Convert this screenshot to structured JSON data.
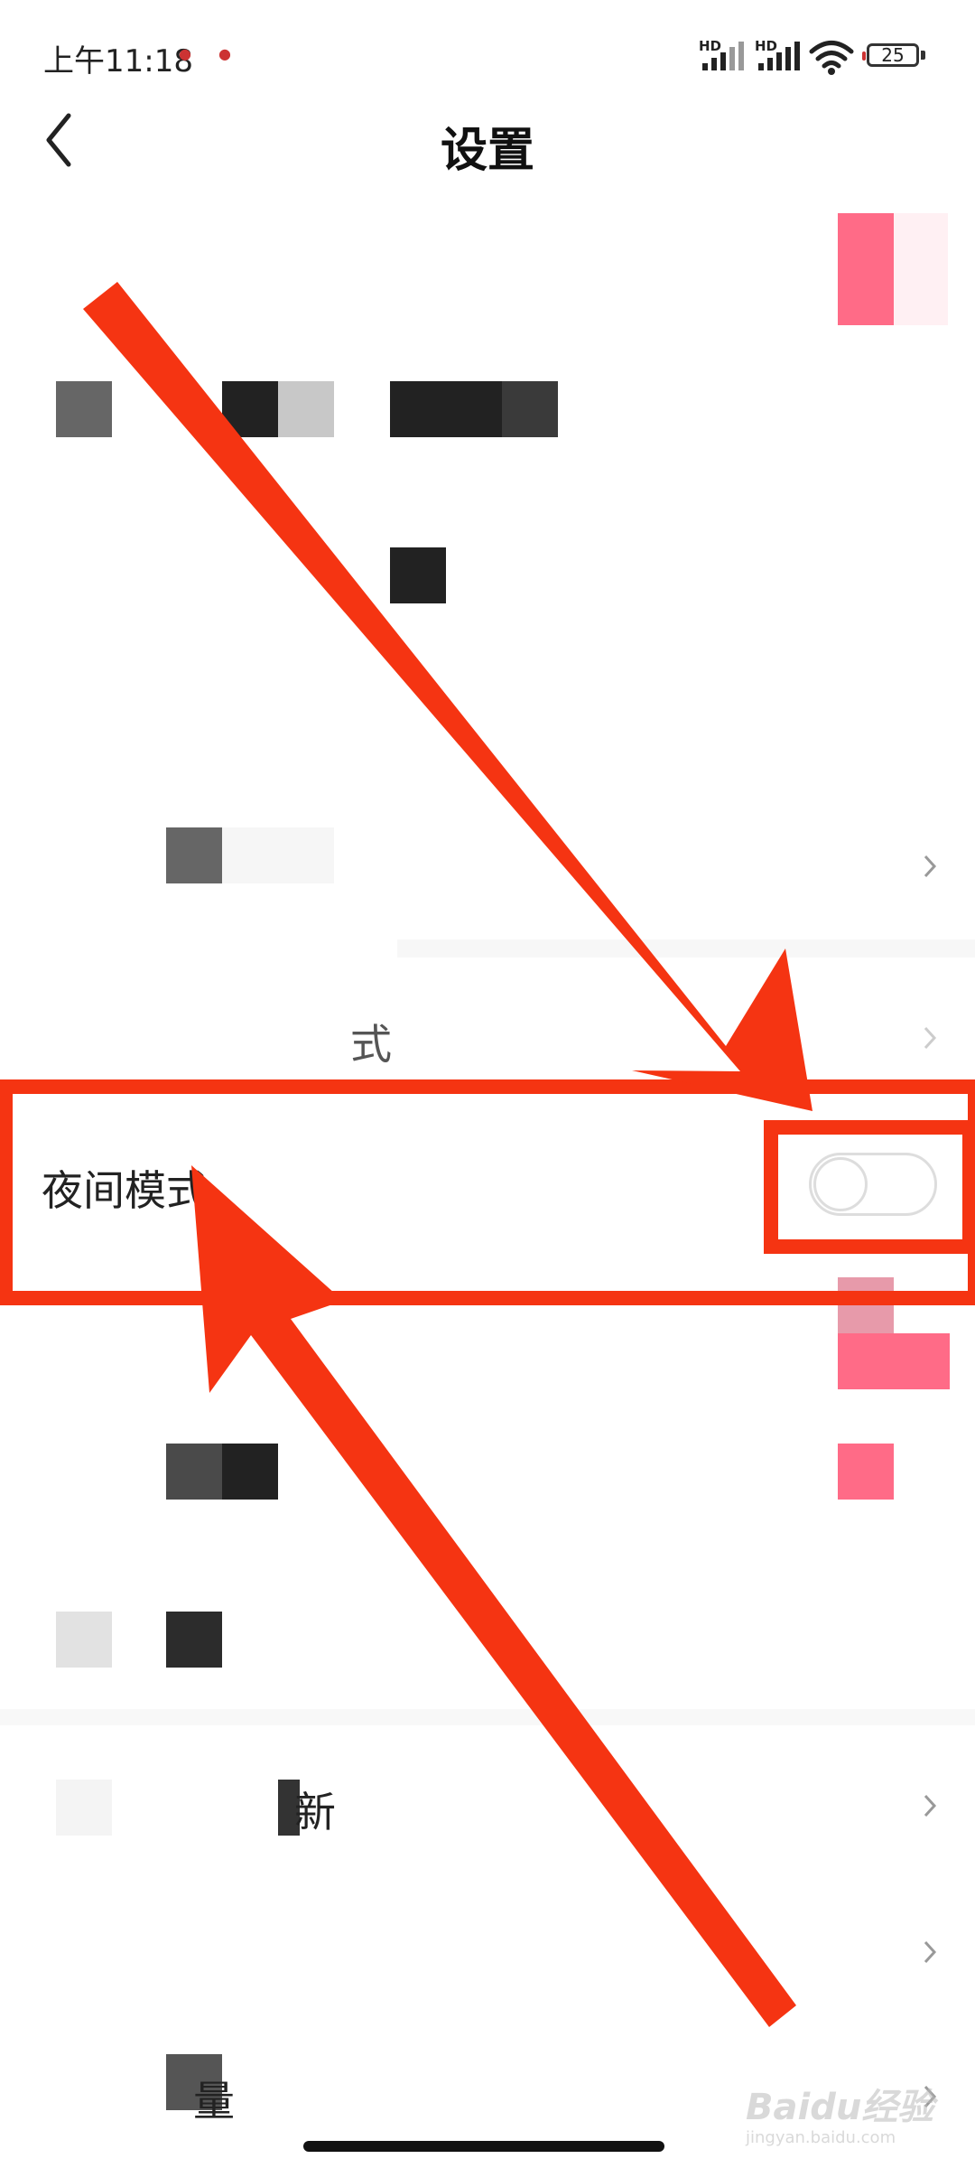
{
  "status_bar": {
    "time": "上午11:18",
    "hd_1": "HD",
    "hd_2": "HD",
    "battery": "25"
  },
  "header": {
    "title": "设置"
  },
  "rows": {
    "partial_1": "式",
    "night_mode": "夜间模式",
    "partial_2": "新",
    "partial_3": "量"
  },
  "night_mode": {
    "enabled": false
  },
  "watermark": {
    "brand": "Baidu经验",
    "domain": "jingyan.baidu.com"
  },
  "colors": {
    "annotation": "#f53412",
    "pink": "#ff6b87",
    "toggle_border": "#dddddd"
  }
}
